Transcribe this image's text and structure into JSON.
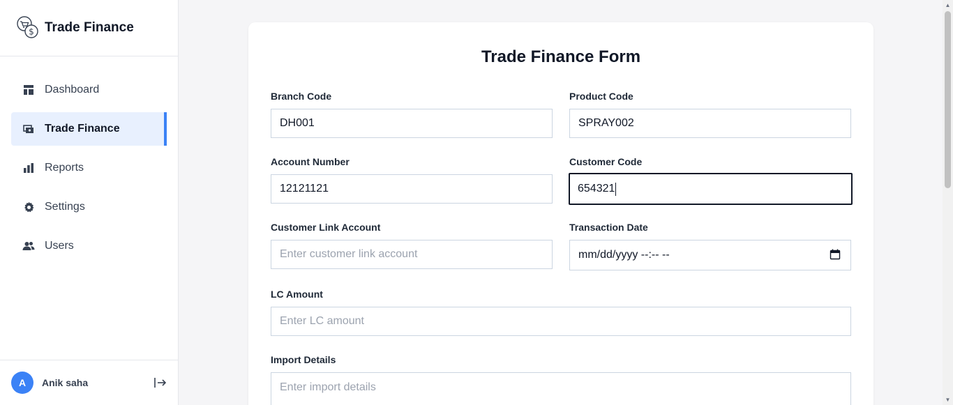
{
  "app": {
    "title": "Trade Finance"
  },
  "sidebar": {
    "items": [
      {
        "label": "Dashboard",
        "icon": "dashboard-icon",
        "active": false
      },
      {
        "label": "Trade Finance",
        "icon": "trade-finance-icon",
        "active": true
      },
      {
        "label": "Reports",
        "icon": "bar-chart-icon",
        "active": false
      },
      {
        "label": "Settings",
        "icon": "gear-icon",
        "active": false
      },
      {
        "label": "Users",
        "icon": "users-icon",
        "active": false
      }
    ]
  },
  "user": {
    "initial": "A",
    "name": "Anik saha",
    "logout_icon": "logout-icon"
  },
  "form": {
    "title": "Trade Finance Form",
    "branch_code": {
      "label": "Branch Code",
      "value": "DH001"
    },
    "product_code": {
      "label": "Product Code",
      "value": "SPRAY002"
    },
    "account_number": {
      "label": "Account Number",
      "value": "12121121"
    },
    "customer_code": {
      "label": "Customer Code",
      "value": "654321"
    },
    "customer_link_account": {
      "label": "Customer Link Account",
      "value": "",
      "placeholder": "Enter customer link account"
    },
    "transaction_date": {
      "label": "Transaction Date",
      "value": "mm/dd/yyyy --:-- --"
    },
    "lc_amount": {
      "label": "LC Amount",
      "value": "",
      "placeholder": "Enter LC amount"
    },
    "import_details": {
      "label": "Import Details",
      "value": "",
      "placeholder": "Enter import details"
    }
  },
  "colors": {
    "accent": "#3b82f6",
    "active_bg": "#e8f0fe",
    "page_bg": "#f5f5f7"
  }
}
